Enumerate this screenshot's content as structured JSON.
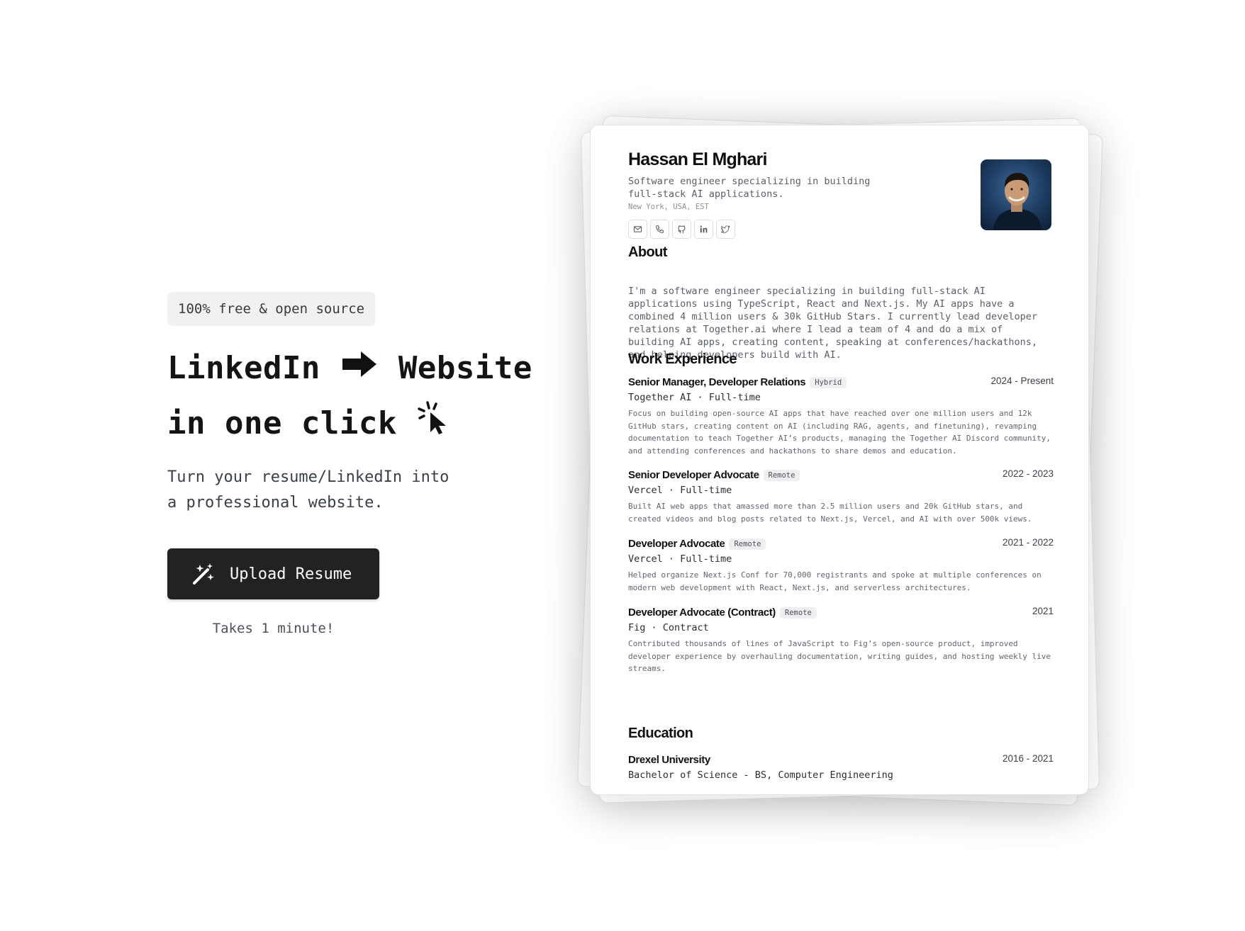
{
  "hero": {
    "badge": "100% free & open source",
    "headline_part1": "LinkedIn",
    "headline_part2": "Website",
    "headline_line2": "in one click",
    "subtitle": "Turn your resume/LinkedIn into a professional website.",
    "upload_label": "Upload Resume",
    "note": "Takes 1 minute!"
  },
  "resume": {
    "name": "Hassan El Mghari",
    "tagline": "Software engineer specializing in building full-stack AI applications.",
    "location": "New York, USA, EST",
    "socials": [
      "mail-icon",
      "phone-icon",
      "github-icon",
      "linkedin-icon",
      "twitter-icon"
    ],
    "about_title": "About",
    "about_text": "I'm a software engineer specializing in building full-stack AI applications using TypeScript, React and Next.js. My AI apps have a combined 4 million users & 30k GitHub Stars. I currently lead developer relations at Together.ai where I lead a team of 4 and do a mix of building AI apps, creating content, speaking at conferences/hackathons, and helping developers build with AI.",
    "work_title": "Work Experience",
    "jobs": [
      {
        "title": "Senior Manager, Developer Relations",
        "tag": "Hybrid",
        "dates": "2024 - Present",
        "company": "Together AI · Full-time",
        "description": "Focus on building open-source AI apps that have reached over one million users and 12k GitHub stars, creating content on AI (including RAG, agents, and finetuning), revamping documentation to teach Together AI’s products, managing the Together AI Discord community, and attending conferences and hackathons to share demos and education."
      },
      {
        "title": "Senior Developer Advocate",
        "tag": "Remote",
        "dates": "2022 - 2023",
        "company": "Vercel · Full-time",
        "description": "Built AI web apps that amassed more than 2.5 million users and 20k GitHub stars, and created videos and blog posts related to Next.js, Vercel, and AI with over 500k views."
      },
      {
        "title": "Developer Advocate",
        "tag": "Remote",
        "dates": "2021 - 2022",
        "company": "Vercel · Full-time",
        "description": "Helped organize Next.js Conf for 70,000 registrants and spoke at multiple conferences on modern web development with React, Next.js, and serverless architectures."
      },
      {
        "title": "Developer Advocate (Contract)",
        "tag": "Remote",
        "dates": "2021",
        "company": "Fig · Contract",
        "description": "Contributed thousands of lines of JavaScript to Fig’s open-source product, improved developer experience by overhauling documentation, writing guides, and hosting weekly live streams."
      }
    ],
    "education_title": "Education",
    "education": {
      "school": "Drexel University",
      "dates": "2016 - 2021",
      "degree": "Bachelor of Science - BS, Computer Engineering"
    }
  }
}
